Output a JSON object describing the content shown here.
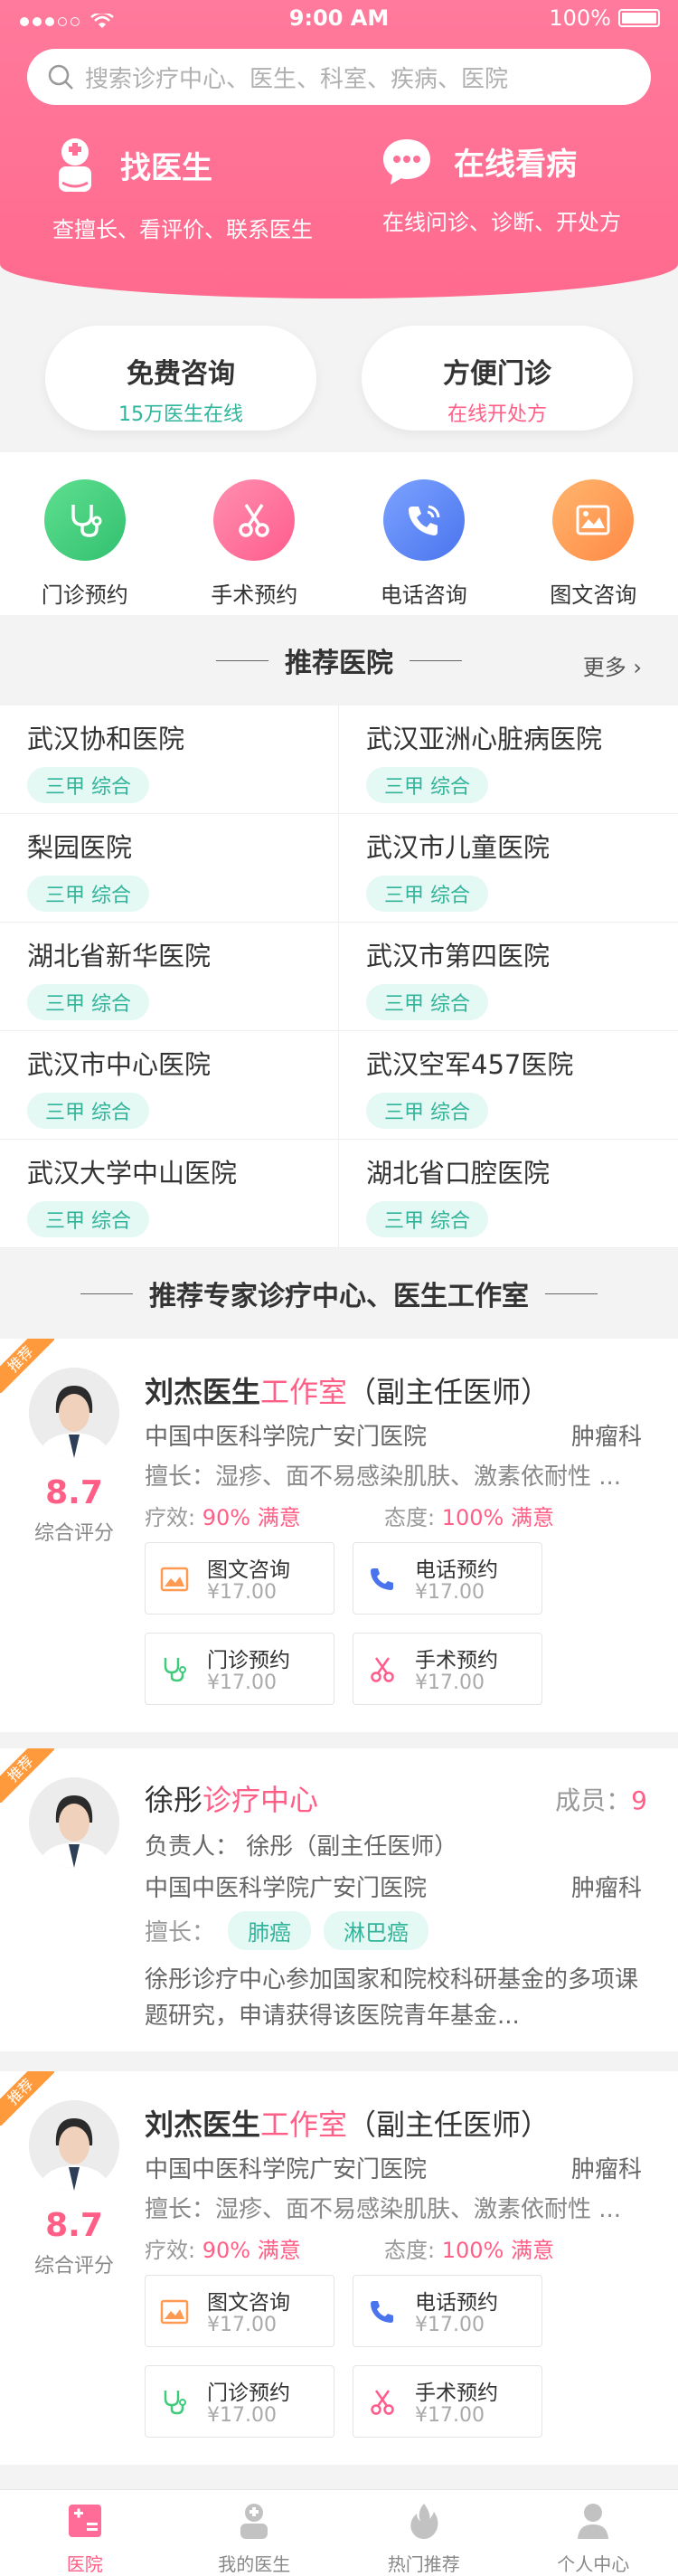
{
  "status": {
    "time": "9:00 AM",
    "battery": "100%"
  },
  "search": {
    "placeholder": "搜索诊疗中心、医生、科室、疾病、医院"
  },
  "header": {
    "left": {
      "title": "找医生",
      "sub": "查擅长、看评价、联系医生",
      "icon": "doctor-icon"
    },
    "right": {
      "title": "在线看病",
      "sub": "在线问诊、诊断、开处方",
      "icon": "chat-icon"
    }
  },
  "pills": [
    {
      "title": "免费咨询",
      "sub": "15万医生在线",
      "color": "#2fb69b"
    },
    {
      "title": "方便门诊",
      "sub": "在线开处方",
      "color": "#ff5f86"
    }
  ],
  "categories": [
    {
      "label": "门诊预约",
      "icon": "stethoscope-icon",
      "color": "#3ecb7a"
    },
    {
      "label": "手术预约",
      "icon": "scissors-icon",
      "color": "#ff6c98"
    },
    {
      "label": "电话咨询",
      "icon": "phone-icon",
      "color": "#5a86f7"
    },
    {
      "label": "图文咨询",
      "icon": "image-icon",
      "color": "#ff9a52"
    }
  ],
  "hospitals": {
    "title": "推荐医院",
    "more": "更多",
    "items": [
      {
        "name": "武汉协和医院",
        "tag": "三甲 综合"
      },
      {
        "name": "武汉亚洲心脏病医院",
        "tag": "三甲 综合"
      },
      {
        "name": "梨园医院",
        "tag": "三甲 综合"
      },
      {
        "name": "武汉市儿童医院",
        "tag": "三甲 综合"
      },
      {
        "name": "湖北省新华医院",
        "tag": "三甲 综合"
      },
      {
        "name": "武汉市第四医院",
        "tag": "三甲 综合"
      },
      {
        "name": "武汉市中心医院",
        "tag": "三甲 综合"
      },
      {
        "name": "武汉空军457医院",
        "tag": "三甲 综合"
      },
      {
        "name": "武汉大学中山医院",
        "tag": "三甲 综合"
      },
      {
        "name": "湖北省口腔医院",
        "tag": "三甲 综合"
      }
    ]
  },
  "experts": {
    "title": "推荐专家诊疗中心、医生工作室",
    "ribbon": "推荐",
    "card1": {
      "name": "刘杰医生",
      "studio": "工作室",
      "grade": "（副主任医师）",
      "hospital": "中国中医科学院广安门医院",
      "dept": "肿瘤科",
      "expertise": "擅长：湿疹、面不易感染肌肤、激素依耐性 ...",
      "efficacy_label": "疗效:",
      "efficacy": "90% 满意",
      "attitude_label": "态度:",
      "attitude": "100% 满意",
      "score": "8.7",
      "score_label": "综合评分",
      "services": [
        {
          "label": "图文咨询",
          "price": "¥17.00",
          "icon": "image-icon"
        },
        {
          "label": "电话预约",
          "price": "¥17.00",
          "icon": "phone-icon"
        },
        {
          "label": "门诊预约",
          "price": "¥17.00",
          "icon": "stethoscope-icon"
        },
        {
          "label": "手术预约",
          "price": "¥17.00",
          "icon": "scissors-icon"
        }
      ]
    },
    "card2": {
      "name": "徐彤",
      "center": "诊疗中心",
      "members_label": "成员：",
      "members": "9",
      "leader": "负责人：  徐彤（副主任医师）",
      "hospital": "中国中医科学院广安门医院",
      "dept": "肿瘤科",
      "expertise_label": "擅长：",
      "tags": [
        "肺癌",
        "淋巴癌"
      ],
      "desc": "徐彤诊疗中心参加国家和院校科研基金的多项课题研究，申请获得该医院青年基金..."
    },
    "card3": {
      "name": "刘杰医生",
      "studio": "工作室",
      "grade": "（副主任医师）",
      "hospital": "中国中医科学院广安门医院",
      "dept": "肿瘤科",
      "expertise": "擅长：湿疹、面不易感染肌肤、激素依耐性 ...",
      "efficacy_label": "疗效:",
      "efficacy": "90% 满意",
      "attitude_label": "态度:",
      "attitude": "100% 满意",
      "score": "8.7",
      "score_label": "综合评分",
      "services": [
        {
          "label": "图文咨询",
          "price": "¥17.00",
          "icon": "image-icon"
        },
        {
          "label": "电话预约",
          "price": "¥17.00",
          "icon": "phone-icon"
        },
        {
          "label": "门诊预约",
          "price": "¥17.00",
          "icon": "stethoscope-icon"
        },
        {
          "label": "手术预约",
          "price": "¥17.00",
          "icon": "scissors-icon"
        }
      ]
    }
  },
  "tabs": [
    {
      "label": "医院",
      "icon": "hospital-icon",
      "active": true
    },
    {
      "label": "我的医生",
      "icon": "doctor-icon",
      "active": false
    },
    {
      "label": "热门推荐",
      "icon": "fire-icon",
      "active": false
    },
    {
      "label": "个人中心",
      "icon": "person-icon",
      "active": false
    }
  ]
}
